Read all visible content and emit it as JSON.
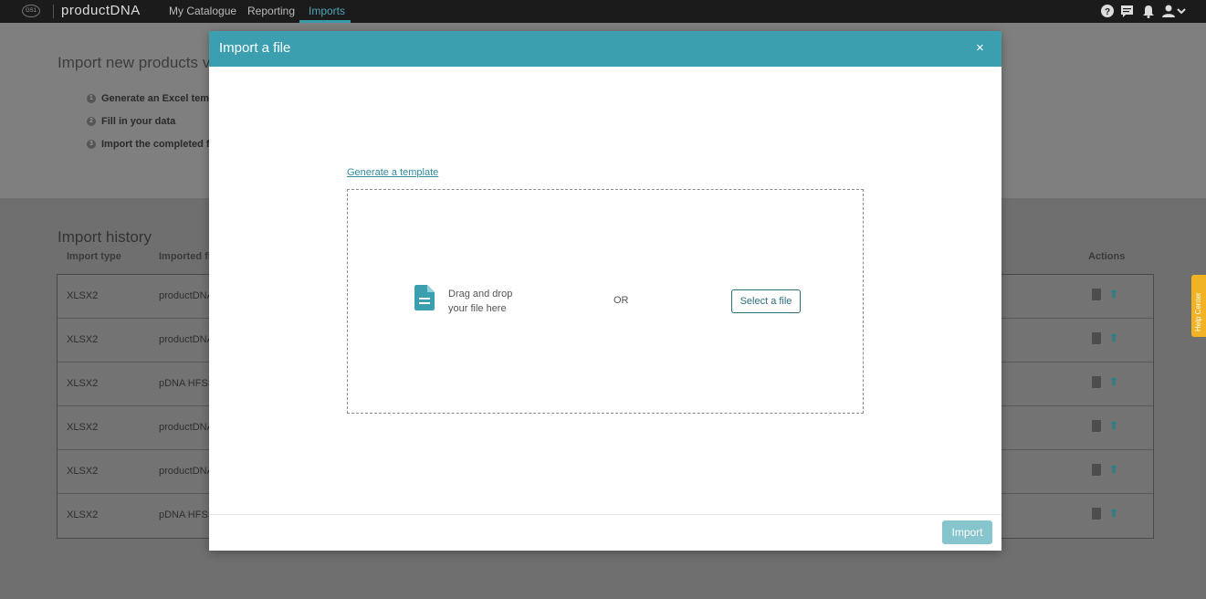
{
  "topbar": {
    "logo_text": "GS1",
    "brand": "productDNA",
    "nav": [
      "My Catalogue",
      "Reporting",
      "Imports"
    ],
    "active_nav": "Imports",
    "icons": [
      "help-icon",
      "chat-icon",
      "bell-icon",
      "user-icon",
      "chevron-down-icon"
    ]
  },
  "background_page": {
    "title": "Import new products v",
    "steps": [
      {
        "num": "1",
        "label": "Generate an Excel templa"
      },
      {
        "num": "2",
        "label": "Fill in your data"
      },
      {
        "num": "3",
        "label": "Import the completed fil"
      }
    ],
    "history_title": "Import history",
    "headers": {
      "type": "Import type",
      "file": "Imported fil",
      "actions": "Actions"
    },
    "rows": [
      {
        "type": "XLSX2",
        "file": "productDNA"
      },
      {
        "type": "XLSX2",
        "file": "productDNA"
      },
      {
        "type": "XLSX2",
        "file": "pDNA HFSS"
      },
      {
        "type": "XLSX2",
        "file": "productDNA"
      },
      {
        "type": "XLSX2",
        "file": "productDNA"
      },
      {
        "type": "XLSX2",
        "file": "pDNA HFSS"
      }
    ]
  },
  "help_tab": "Help Center",
  "modal": {
    "title": "Import a file",
    "close": "×",
    "generate_link": "Generate a template",
    "drop_line1": "Drag and drop",
    "drop_line2": "your file here",
    "or": "OR",
    "select_button": "Select a file",
    "import_button": "Import"
  },
  "colors": {
    "accent": "#3b9fb0",
    "import_disabled": "#86c4ce",
    "help_tab": "#f1b323"
  }
}
